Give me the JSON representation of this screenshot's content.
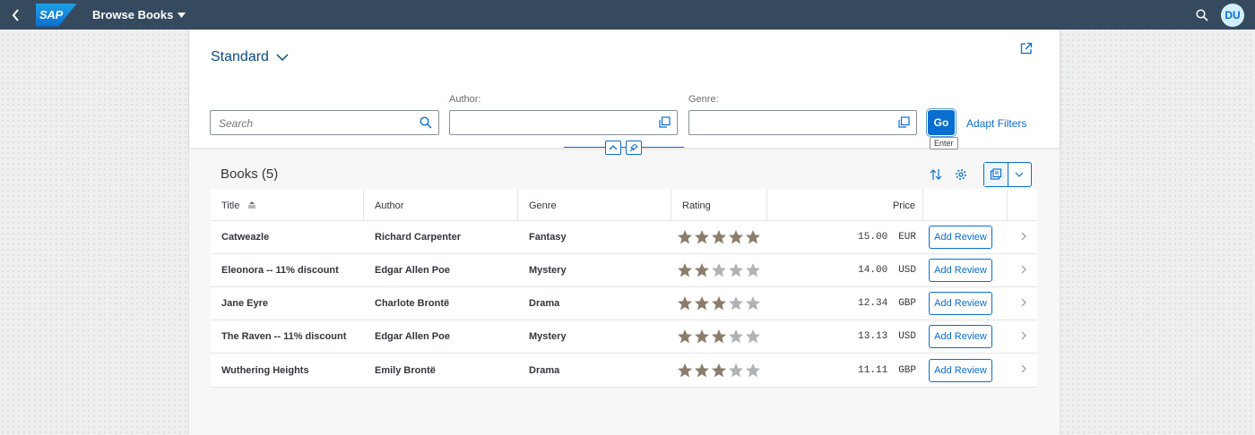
{
  "shell": {
    "logo_text": "SAP",
    "app_title": "Browse Books",
    "avatar_initials": "DU"
  },
  "header": {
    "variant_label": "Standard",
    "filters": {
      "search_placeholder": "Search",
      "author_label": "Author:",
      "author_value": "",
      "genre_label": "Genre:",
      "genre_value": ""
    },
    "go_label": "Go",
    "go_tooltip": "Enter",
    "adapt_filters_label": "Adapt Filters"
  },
  "table": {
    "title": "Books (5)",
    "columns": [
      "Title",
      "Author",
      "Genre",
      "Rating",
      "Price"
    ],
    "rows": [
      {
        "title": "Catweazle",
        "author": "Richard Carpenter",
        "genre": "Fantasy",
        "rating": 5,
        "price": "15.00",
        "currency": "EUR",
        "action": "Add Review"
      },
      {
        "title": "Eleonora -- 11% discount",
        "author": "Edgar Allen Poe",
        "genre": "Mystery",
        "rating": 2,
        "price": "14.00",
        "currency": "USD",
        "action": "Add Review"
      },
      {
        "title": "Jane Eyre",
        "author": "Charlote Brontë",
        "genre": "Drama",
        "rating": 3,
        "price": "12.34",
        "currency": "GBP",
        "action": "Add Review"
      },
      {
        "title": "The Raven -- 11% discount",
        "author": "Edgar Allen Poe",
        "genre": "Mystery",
        "rating": 3,
        "price": "13.13",
        "currency": "USD",
        "action": "Add Review"
      },
      {
        "title": "Wuthering Heights",
        "author": "Emily Brontë",
        "genre": "Drama",
        "rating": 3,
        "price": "11.11",
        "currency": "GBP",
        "action": "Add Review"
      }
    ]
  },
  "colors": {
    "shell_bg": "#354a5f",
    "accent": "#0a6ed1",
    "star_filled": "#8c7d6b",
    "star_empty": "#b0b3b6"
  },
  "icons": [
    "back-icon",
    "dropdown-icon",
    "search-icon",
    "avatar",
    "variant-chevron-icon",
    "share-icon",
    "value-help-icon",
    "collapse-icon",
    "pin-icon",
    "sort-icon",
    "settings-icon",
    "export-icon",
    "chevron-down-icon",
    "sort-ascending-icon",
    "star-icon",
    "navigation-chevron-icon"
  ]
}
